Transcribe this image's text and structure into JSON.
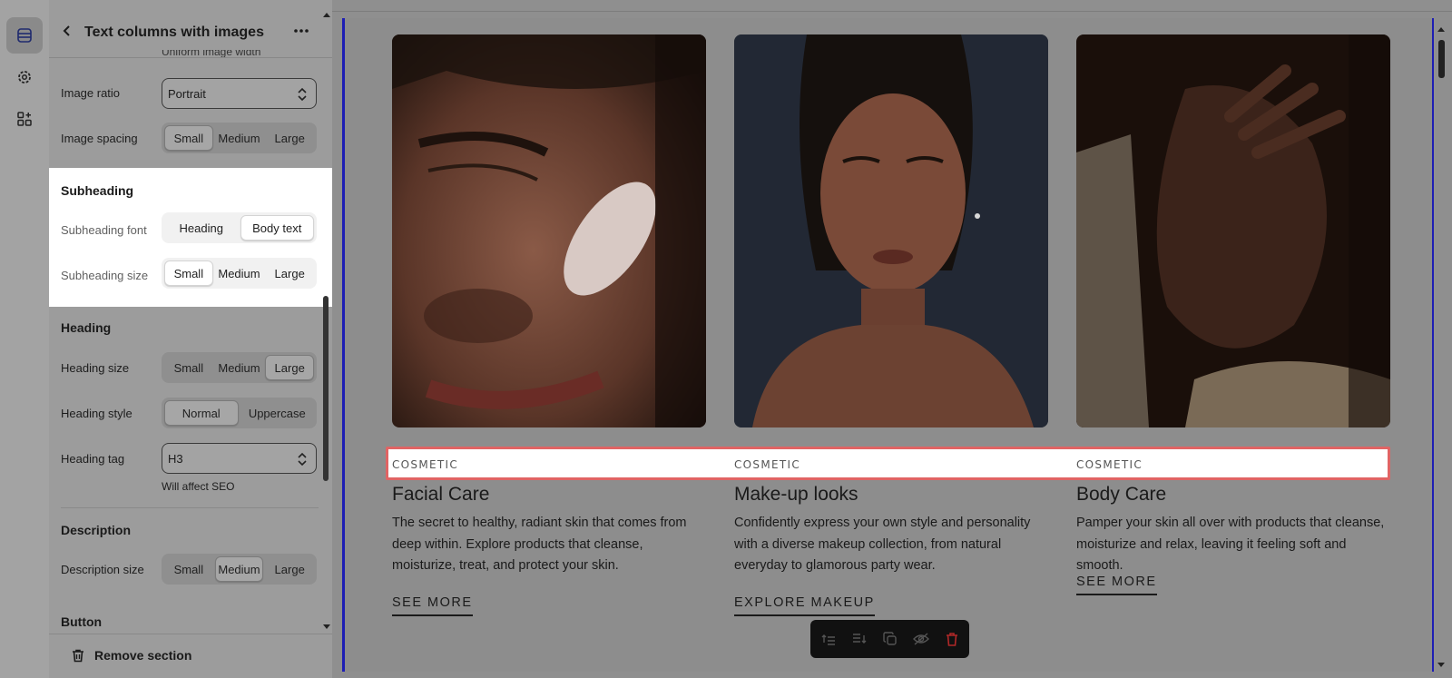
{
  "rail": {
    "items": [
      {
        "icon": "sections-icon",
        "active": true
      },
      {
        "icon": "settings-gear-icon",
        "active": false
      },
      {
        "icon": "apps-add-icon",
        "active": false
      }
    ]
  },
  "panel": {
    "title": "Text columns with images",
    "cutoff_text": "Uniform image width",
    "image_ratio": {
      "label": "Image ratio",
      "value": "Portrait"
    },
    "image_spacing": {
      "label": "Image spacing",
      "options": [
        "Small",
        "Medium",
        "Large"
      ],
      "selected": "Small"
    },
    "subheading": {
      "title": "Subheading",
      "font": {
        "label": "Subheading font",
        "options": [
          "Heading",
          "Body text"
        ],
        "selected": "Body text"
      },
      "size": {
        "label": "Subheading size",
        "options": [
          "Small",
          "Medium",
          "Large"
        ],
        "selected": "Small"
      }
    },
    "heading": {
      "title": "Heading",
      "size": {
        "label": "Heading size",
        "options": [
          "Small",
          "Medium",
          "Large"
        ],
        "selected": "Large"
      },
      "style": {
        "label": "Heading style",
        "options": [
          "Normal",
          "Uppercase"
        ],
        "selected": "Normal"
      },
      "tag": {
        "label": "Heading tag",
        "value": "H3",
        "hint": "Will affect SEO"
      }
    },
    "description": {
      "title": "Description",
      "size": {
        "label": "Description size",
        "options": [
          "Small",
          "Medium",
          "Large"
        ],
        "selected": "Medium"
      }
    },
    "button": {
      "title": "Button"
    },
    "remove_label": "Remove section"
  },
  "preview": {
    "columns": [
      {
        "subheading": "COSMETIC",
        "title": "Facial Care",
        "description": "The secret to healthy, radiant skin that comes from deep within. Explore products that cleanse, moisturize, treat, and protect your skin.",
        "link": "SEE MORE"
      },
      {
        "subheading": "COSMETIC",
        "title": "Make-up looks",
        "description": "Confidently express your own style and personality with a diverse makeup collection, from natural everyday to glamorous party wear.",
        "link": "EXPLORE MAKEUP"
      },
      {
        "subheading": "COSMETIC",
        "title": "Body Care",
        "description": "Pamper your skin all over with products that cleanse, moisturize and relax, leaving it feeling soft and smooth.",
        "link": "SEE MORE"
      }
    ],
    "toolbar_icons": [
      "move-up-icon",
      "move-down-icon",
      "duplicate-icon",
      "hide-icon",
      "delete-icon"
    ]
  },
  "colors": {
    "selection_outline": "#1e1eb4",
    "highlight_border": "#e06464",
    "delete_red": "#d03030"
  }
}
